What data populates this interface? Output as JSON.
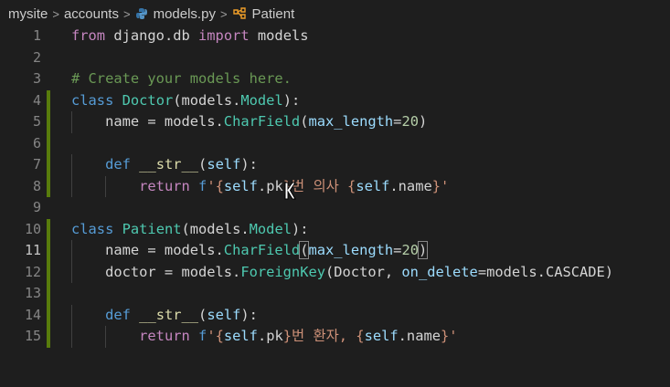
{
  "breadcrumb": {
    "folder1": "mysite",
    "folder2": "accounts",
    "file": "models.py",
    "symbol": "Patient"
  },
  "editor": {
    "line_numbers": [
      "1",
      "2",
      "3",
      "4",
      "5",
      "6",
      "7",
      "8",
      "9",
      "10",
      "11",
      "12",
      "13",
      "14",
      "15"
    ],
    "lines": [
      {
        "num": "1",
        "tokens": [
          [
            "from",
            "ctl"
          ],
          [
            " django.db ",
            "pl"
          ],
          [
            "import",
            "ctl"
          ],
          [
            " models",
            "pl"
          ]
        ]
      },
      {
        "num": "2",
        "tokens": []
      },
      {
        "num": "3",
        "tokens": [
          [
            "# Create your models here.",
            "cm"
          ]
        ]
      },
      {
        "num": "4",
        "tokens": [
          [
            "class",
            "kw"
          ],
          [
            " ",
            "pl"
          ],
          [
            "Doctor",
            "ty"
          ],
          [
            "(models.",
            "pl"
          ],
          [
            "Model",
            "ty"
          ],
          [
            "):",
            "pl"
          ]
        ]
      },
      {
        "num": "5",
        "tokens": [
          [
            "    name = models.",
            "pl"
          ],
          [
            "CharField",
            "ty"
          ],
          [
            "(",
            "pl"
          ],
          [
            "max_length",
            "va"
          ],
          [
            "=",
            "pl"
          ],
          [
            "20",
            "nu"
          ],
          [
            ")",
            "pl"
          ]
        ]
      },
      {
        "num": "6",
        "tokens": []
      },
      {
        "num": "7",
        "tokens": [
          [
            "    ",
            "pl"
          ],
          [
            "def",
            "kw"
          ],
          [
            " ",
            "pl"
          ],
          [
            "__str__",
            "fn"
          ],
          [
            "(",
            "pl"
          ],
          [
            "self",
            "va"
          ],
          [
            "):",
            "pl"
          ]
        ]
      },
      {
        "num": "8",
        "tokens": [
          [
            "        ",
            "pl"
          ],
          [
            "return",
            "ctl"
          ],
          [
            " ",
            "pl"
          ],
          [
            "f",
            "kw"
          ],
          [
            "'{",
            "st"
          ],
          [
            "self",
            "va"
          ],
          [
            ".pk",
            "pl"
          ],
          [
            "}번 의사 ",
            "st"
          ],
          [
            "{",
            "st"
          ],
          [
            "self",
            "va"
          ],
          [
            ".name",
            "pl"
          ],
          [
            "}'",
            "st"
          ]
        ]
      },
      {
        "num": "9",
        "tokens": []
      },
      {
        "num": "10",
        "tokens": [
          [
            "class",
            "kw"
          ],
          [
            " ",
            "pl"
          ],
          [
            "Patient",
            "ty"
          ],
          [
            "(models.",
            "pl"
          ],
          [
            "Model",
            "ty"
          ],
          [
            "):",
            "pl"
          ]
        ]
      },
      {
        "num": "11",
        "tokens": [
          [
            "    name = models.",
            "pl"
          ],
          [
            "CharField",
            "ty"
          ],
          [
            "(",
            "pl"
          ],
          [
            "max_length",
            "va"
          ],
          [
            "=",
            "pl"
          ],
          [
            "20",
            "nu"
          ],
          [
            ")",
            "pl"
          ]
        ]
      },
      {
        "num": "12",
        "tokens": [
          [
            "    doctor = models.",
            "pl"
          ],
          [
            "ForeignKey",
            "ty"
          ],
          [
            "(Doctor, ",
            "pl"
          ],
          [
            "on_delete",
            "va"
          ],
          [
            "=models.CASCADE)",
            "pl"
          ]
        ]
      },
      {
        "num": "13",
        "tokens": []
      },
      {
        "num": "14",
        "tokens": [
          [
            "    ",
            "pl"
          ],
          [
            "def",
            "kw"
          ],
          [
            " ",
            "pl"
          ],
          [
            "__str__",
            "fn"
          ],
          [
            "(",
            "pl"
          ],
          [
            "self",
            "va"
          ],
          [
            "):",
            "pl"
          ]
        ]
      },
      {
        "num": "15",
        "tokens": [
          [
            "        ",
            "pl"
          ],
          [
            "return",
            "ctl"
          ],
          [
            " ",
            "pl"
          ],
          [
            "f",
            "kw"
          ],
          [
            "'{",
            "st"
          ],
          [
            "self",
            "va"
          ],
          [
            ".pk",
            "pl"
          ],
          [
            "}번 환자, ",
            "st"
          ],
          [
            "{",
            "st"
          ],
          [
            "self",
            "va"
          ],
          [
            ".name",
            "pl"
          ],
          [
            "}'",
            "st"
          ]
        ]
      }
    ],
    "modified_lines": [
      "4",
      "5",
      "6",
      "7",
      "8",
      "10",
      "11",
      "12",
      "13",
      "14",
      "15"
    ],
    "active_line": "11"
  },
  "colors": {
    "background": "#1e1e1e",
    "keyword": "#569cd6",
    "control": "#c586c0",
    "type": "#4ec9b0",
    "function": "#dcdcaa",
    "variable": "#9cdcfe",
    "string": "#ce9178",
    "number": "#b5cea8",
    "comment": "#6a9955",
    "modified_gutter": "#587c0c"
  }
}
